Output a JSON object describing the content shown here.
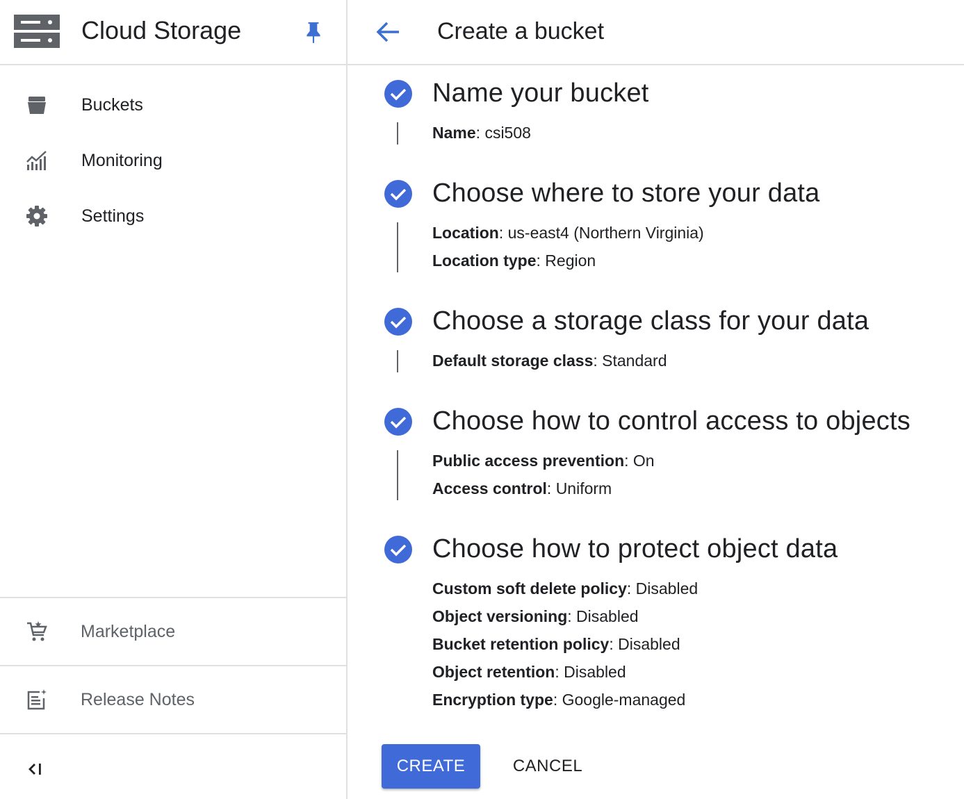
{
  "sidebar": {
    "product_title": "Cloud Storage",
    "items": [
      {
        "label": "Buckets",
        "icon": "bucket-icon"
      },
      {
        "label": "Monitoring",
        "icon": "monitoring-chart-icon"
      },
      {
        "label": "Settings",
        "icon": "gear-icon"
      }
    ],
    "bottom_items": [
      {
        "label": "Marketplace",
        "icon": "cart-icon"
      },
      {
        "label": "Release Notes",
        "icon": "release-notes-icon"
      }
    ],
    "collapse_icon": "collapse-left-icon"
  },
  "header": {
    "title": "Create a bucket",
    "back_icon": "arrow-left-icon"
  },
  "steps": [
    {
      "title": "Name your bucket",
      "details": [
        {
          "label": "Name",
          "value": "csi508"
        }
      ]
    },
    {
      "title": "Choose where to store your data",
      "details": [
        {
          "label": "Location",
          "value": "us-east4 (Northern Virginia)"
        },
        {
          "label": "Location type",
          "value": "Region"
        }
      ]
    },
    {
      "title": "Choose a storage class for your data",
      "details": [
        {
          "label": "Default storage class",
          "value": "Standard"
        }
      ]
    },
    {
      "title": "Choose how to control access to objects",
      "details": [
        {
          "label": "Public access prevention",
          "value": "On"
        },
        {
          "label": "Access control",
          "value": "Uniform"
        }
      ]
    },
    {
      "title": "Choose how to protect object data",
      "details": [
        {
          "label": "Custom soft delete policy",
          "value": "Disabled"
        },
        {
          "label": "Object versioning",
          "value": "Disabled"
        },
        {
          "label": "Bucket retention policy",
          "value": "Disabled"
        },
        {
          "label": "Object retention",
          "value": "Disabled"
        },
        {
          "label": "Encryption type",
          "value": "Google-managed"
        }
      ]
    }
  ],
  "actions": {
    "create_label": "CREATE",
    "cancel_label": "CANCEL"
  },
  "colors": {
    "accent": "#3f6ad8",
    "pin": "#3c6fd1",
    "icon_gray": "#5f6368",
    "divider": "#e0e0e0"
  }
}
